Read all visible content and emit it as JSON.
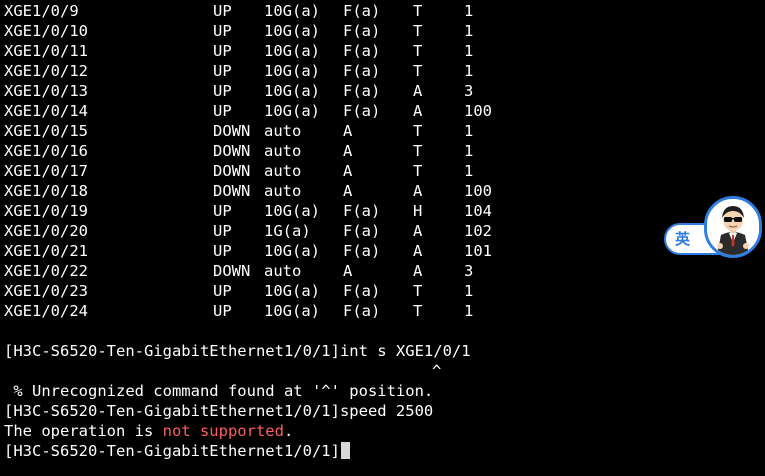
{
  "colors": {
    "background": "#000000",
    "text": "#ffffff",
    "error_highlight": "#ff5c5c",
    "ime_accent": "#2f7de1"
  },
  "interfaces": [
    {
      "name": "XGE1/0/9",
      "status": "UP",
      "speed": "10G(a)",
      "duplex": "F(a)",
      "type": "T",
      "pvid": "1"
    },
    {
      "name": "XGE1/0/10",
      "status": "UP",
      "speed": "10G(a)",
      "duplex": "F(a)",
      "type": "T",
      "pvid": "1"
    },
    {
      "name": "XGE1/0/11",
      "status": "UP",
      "speed": "10G(a)",
      "duplex": "F(a)",
      "type": "T",
      "pvid": "1"
    },
    {
      "name": "XGE1/0/12",
      "status": "UP",
      "speed": "10G(a)",
      "duplex": "F(a)",
      "type": "T",
      "pvid": "1"
    },
    {
      "name": "XGE1/0/13",
      "status": "UP",
      "speed": "10G(a)",
      "duplex": "F(a)",
      "type": "A",
      "pvid": "3"
    },
    {
      "name": "XGE1/0/14",
      "status": "UP",
      "speed": "10G(a)",
      "duplex": "F(a)",
      "type": "A",
      "pvid": "100"
    },
    {
      "name": "XGE1/0/15",
      "status": "DOWN",
      "speed": "auto",
      "duplex": "A",
      "type": "T",
      "pvid": "1"
    },
    {
      "name": "XGE1/0/16",
      "status": "DOWN",
      "speed": "auto",
      "duplex": "A",
      "type": "T",
      "pvid": "1"
    },
    {
      "name": "XGE1/0/17",
      "status": "DOWN",
      "speed": "auto",
      "duplex": "A",
      "type": "T",
      "pvid": "1"
    },
    {
      "name": "XGE1/0/18",
      "status": "DOWN",
      "speed": "auto",
      "duplex": "A",
      "type": "A",
      "pvid": "100"
    },
    {
      "name": "XGE1/0/19",
      "status": "UP",
      "speed": "10G(a)",
      "duplex": "F(a)",
      "type": "H",
      "pvid": "104"
    },
    {
      "name": "XGE1/0/20",
      "status": "UP",
      "speed": "1G(a)",
      "duplex": "F(a)",
      "type": "A",
      "pvid": "102"
    },
    {
      "name": "XGE1/0/21",
      "status": "UP",
      "speed": "10G(a)",
      "duplex": "F(a)",
      "type": "A",
      "pvid": "101"
    },
    {
      "name": "XGE1/0/22",
      "status": "DOWN",
      "speed": "auto",
      "duplex": "A",
      "type": "A",
      "pvid": "3"
    },
    {
      "name": "XGE1/0/23",
      "status": "UP",
      "speed": "10G(a)",
      "duplex": "F(a)",
      "type": "T",
      "pvid": "1"
    },
    {
      "name": "XGE1/0/24",
      "status": "UP",
      "speed": "10G(a)",
      "duplex": "F(a)",
      "type": "T",
      "pvid": "1"
    }
  ],
  "session": {
    "command1": "[H3C-S6520-Ten-GigabitEthernet1/0/1]int s XGE1/0/1",
    "caret": "^",
    "error": " % Unrecognized command found at '^' position.",
    "command2": "[H3C-S6520-Ten-GigabitEthernet1/0/1]speed 2500",
    "result_prefix": "The operation is ",
    "result_highlight": "not supported",
    "result_suffix": ".",
    "prompt": "[H3C-S6520-Ten-GigabitEthernet1/0/1]"
  },
  "ime": {
    "mode_char": "英",
    "avatar_icon": "cartoon-man-in-suit-icon"
  }
}
